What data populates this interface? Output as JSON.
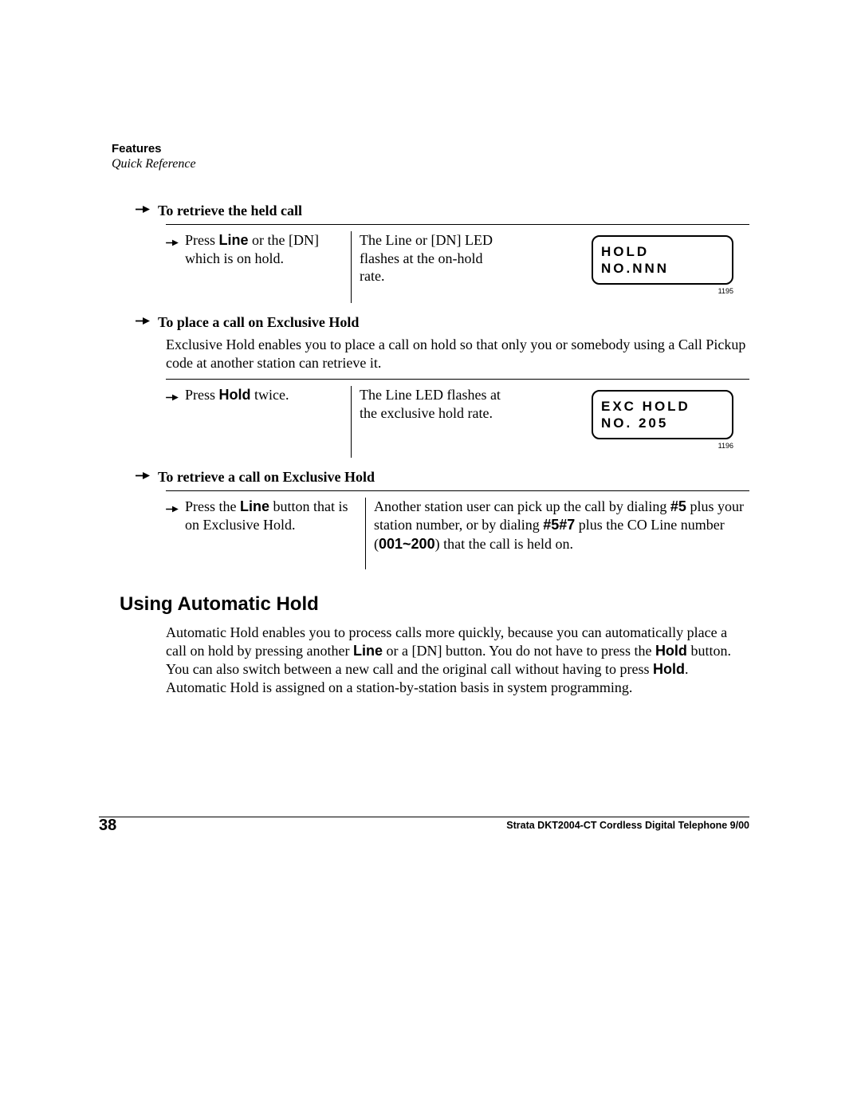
{
  "header": {
    "features": "Features",
    "quickref": "Quick Reference"
  },
  "sec1": {
    "title": "To retrieve the held call",
    "col1_a": "Press ",
    "col1_b": "Line",
    "col1_c": " or the [DN] which is on hold.",
    "col2": "The Line or [DN] LED flashes at the on-hold rate.",
    "lcd1": "HOLD",
    "lcd2": "NO.NNN",
    "lcd_id": "1195"
  },
  "sec2": {
    "title": "To place a call on Exclusive Hold",
    "intro": "Exclusive Hold enables you to place a call on hold so that only you or somebody using a Call Pickup code at another station can retrieve it.",
    "col1_a": "Press ",
    "col1_b": "Hold",
    "col1_c": " twice.",
    "col2": "The Line LED flashes at the exclusive hold rate.",
    "lcd1": "EXC HOLD",
    "lcd2": "NO. 205",
    "lcd_id": "1196"
  },
  "sec3": {
    "title": "To retrieve a call on Exclusive Hold",
    "col1_a": "Press the ",
    "col1_b": "Line",
    "col1_c": " button that is on Exclusive Hold.",
    "col2_a": "Another station user can pick up the call by dialing ",
    "col2_b": "#5",
    "col2_c": " plus your station number, or by dialing ",
    "col2_d": "#5#7",
    "col2_e": " plus the CO Line number (",
    "col2_f": "001~200",
    "col2_g": ") that the call is held on."
  },
  "sec4": {
    "title": "Using Automatic Hold",
    "p_a": "Automatic Hold enables you to process calls more quickly, because you can automatically place a call on hold by pressing another ",
    "p_b": "Line",
    "p_c": " or a [DN] button. You do not have to press the ",
    "p_d": "Hold",
    "p_e": " button. You can also switch between a new call and the original call without having to press ",
    "p_f": "Hold",
    "p_g": ". Automatic Hold is assigned on a station-by-station basis in system programming."
  },
  "footer": {
    "page": "38",
    "text": "Strata DKT2004-CT Cordless Digital Telephone   9/00"
  }
}
